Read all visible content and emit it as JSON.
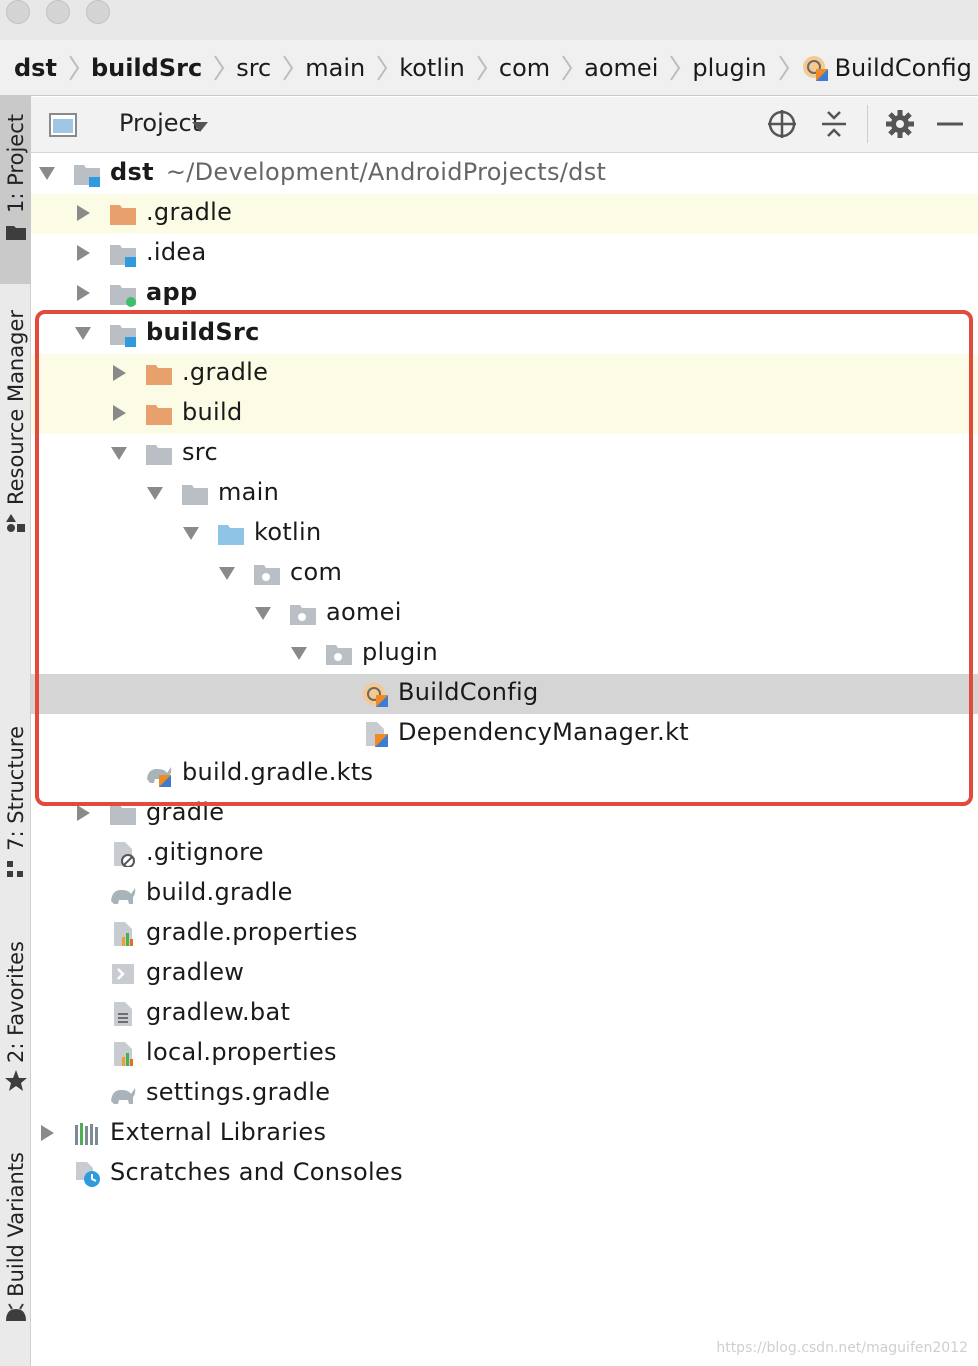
{
  "window": {
    "traffic_lights": [
      "close",
      "minimize",
      "zoom"
    ]
  },
  "breadcrumb": [
    "dst",
    "buildSrc",
    "src",
    "main",
    "kotlin",
    "com",
    "aomei",
    "plugin",
    "BuildConfig"
  ],
  "toolstrip": {
    "project": "1: Project",
    "resource_manager": "Resource Manager",
    "structure": "7: Structure",
    "favorites": "2: Favorites",
    "build_variants": "Build Variants"
  },
  "project_header": {
    "title": "Project"
  },
  "tree": {
    "root_name": "dst",
    "root_path": "~/Development/AndroidProjects/dst",
    "rows": [
      {
        "label": ".gradle",
        "icon": "folder-orange-icon",
        "expander": "collapsed",
        "bold": false
      },
      {
        "label": ".idea",
        "icon": "folder-module-icon",
        "expander": "collapsed",
        "bold": false
      },
      {
        "label": "app",
        "icon": "folder-app-icon",
        "expander": "collapsed",
        "bold": true
      },
      {
        "label": "buildSrc",
        "icon": "folder-module-icon",
        "expander": "expanded",
        "bold": true
      },
      {
        "label": ".gradle",
        "icon": "folder-orange-icon",
        "expander": "collapsed",
        "bold": false
      },
      {
        "label": "build",
        "icon": "folder-orange-icon",
        "expander": "collapsed",
        "bold": false
      },
      {
        "label": "src",
        "icon": "folder-gray-icon",
        "expander": "expanded",
        "bold": false
      },
      {
        "label": "main",
        "icon": "folder-gray-icon",
        "expander": "expanded",
        "bold": false
      },
      {
        "label": "kotlin",
        "icon": "folder-source-icon",
        "expander": "expanded",
        "bold": false
      },
      {
        "label": "com",
        "icon": "package-icon",
        "expander": "expanded",
        "bold": false
      },
      {
        "label": "aomei",
        "icon": "package-icon",
        "expander": "expanded",
        "bold": false
      },
      {
        "label": "plugin",
        "icon": "package-icon",
        "expander": "expanded",
        "bold": false
      },
      {
        "label": "BuildConfig",
        "icon": "kotlin-object-icon",
        "expander": "none",
        "bold": false
      },
      {
        "label": "DependencyManager.kt",
        "icon": "kotlin-file-icon",
        "expander": "none",
        "bold": false
      },
      {
        "label": "build.gradle.kts",
        "icon": "gradle-kts-icon",
        "expander": "none",
        "bold": false
      },
      {
        "label": "gradle",
        "icon": "folder-gray-icon",
        "expander": "collapsed",
        "bold": false
      },
      {
        "label": ".gitignore",
        "icon": "ignore-file-icon",
        "expander": "none",
        "bold": false
      },
      {
        "label": "build.gradle",
        "icon": "gradle-icon",
        "expander": "none",
        "bold": false
      },
      {
        "label": "gradle.properties",
        "icon": "properties-file-icon",
        "expander": "none",
        "bold": false
      },
      {
        "label": "gradlew",
        "icon": "shell-script-icon",
        "expander": "none",
        "bold": false
      },
      {
        "label": "gradlew.bat",
        "icon": "text-file-icon",
        "expander": "none",
        "bold": false
      },
      {
        "label": "local.properties",
        "icon": "properties-file-icon",
        "expander": "none",
        "bold": false
      },
      {
        "label": "settings.gradle",
        "icon": "gradle-icon",
        "expander": "none",
        "bold": false
      },
      {
        "label": "External Libraries",
        "icon": "libraries-icon",
        "expander": "collapsed",
        "bold": false
      },
      {
        "label": "Scratches and Consoles",
        "icon": "scratches-icon",
        "expander": "none",
        "bold": false
      }
    ],
    "selected_label": "BuildConfig"
  },
  "colors": {
    "highlight_border": "#e24a3b",
    "excluded_row_bg": "#fcfbe5",
    "selected_row_bg": "#d5d5d5",
    "folder_orange": "#e8a16d",
    "folder_gray": "#b9bfc5",
    "folder_source": "#8fc4e6",
    "kotlin_orange": "#f08a24"
  },
  "watermark": "https://blog.csdn.net/maguifen2012"
}
